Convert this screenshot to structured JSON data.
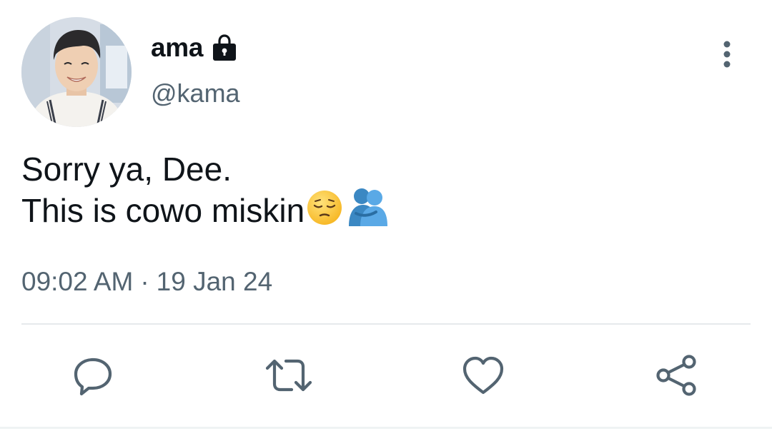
{
  "user": {
    "display_name": "ama",
    "handle": "@kama",
    "protected_icon": "lock-icon",
    "avatar": "profile-photo"
  },
  "tweet": {
    "lines": [
      "Sorry ya, Dee.",
      "This is cowo miskin"
    ],
    "emojis": [
      "pensive-face-emoji",
      "people-hugging-emoji"
    ],
    "time": "09:02 AM",
    "separator": "·",
    "date": "19 Jan 24"
  },
  "menu": {
    "icon": "more-vertical-icon"
  },
  "actions": [
    {
      "name": "reply",
      "icon": "reply-icon"
    },
    {
      "name": "retweet",
      "icon": "retweet-icon"
    },
    {
      "name": "like",
      "icon": "heart-icon"
    },
    {
      "name": "share",
      "icon": "share-icon"
    }
  ],
  "colors": {
    "text": "#0f1419",
    "secondary": "#536471",
    "divider": "#e6e9ec"
  }
}
